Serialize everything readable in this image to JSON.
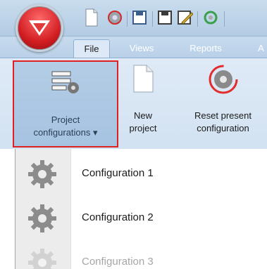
{
  "ribbon_tabs": [
    {
      "label": "File",
      "active": true
    },
    {
      "label": "Views",
      "active": false
    },
    {
      "label": "Reports",
      "active": false
    },
    {
      "label": "A",
      "active": false
    }
  ],
  "ribbon_buttons": {
    "project_configurations": {
      "label": "Project\nconfigurations ▾",
      "icon": "project-list-gear-icon",
      "highlight_color": "#e02020"
    },
    "new_project": {
      "label": "New\nproject",
      "icon": "blank-document-icon"
    },
    "reset_configuration": {
      "label": "Reset present\nconfiguration",
      "icon": "reset-gear-icon"
    }
  },
  "quick_access": [
    "document-icon",
    "reset-icon",
    "save-icon",
    "save-as-icon",
    "edit-icon",
    "refresh-icon"
  ],
  "menu": {
    "items": [
      {
        "label": "Configuration 1",
        "enabled": true,
        "icon": "gear-icon"
      },
      {
        "label": "Configuration 2",
        "enabled": true,
        "icon": "gear-icon"
      },
      {
        "label": "Configuration 3",
        "enabled": false,
        "icon": "gear-icon"
      }
    ]
  },
  "colors": {
    "brand_red": "#d21d22",
    "ribbon_blue": "#b9d0e8",
    "highlight_red": "#e02020"
  }
}
